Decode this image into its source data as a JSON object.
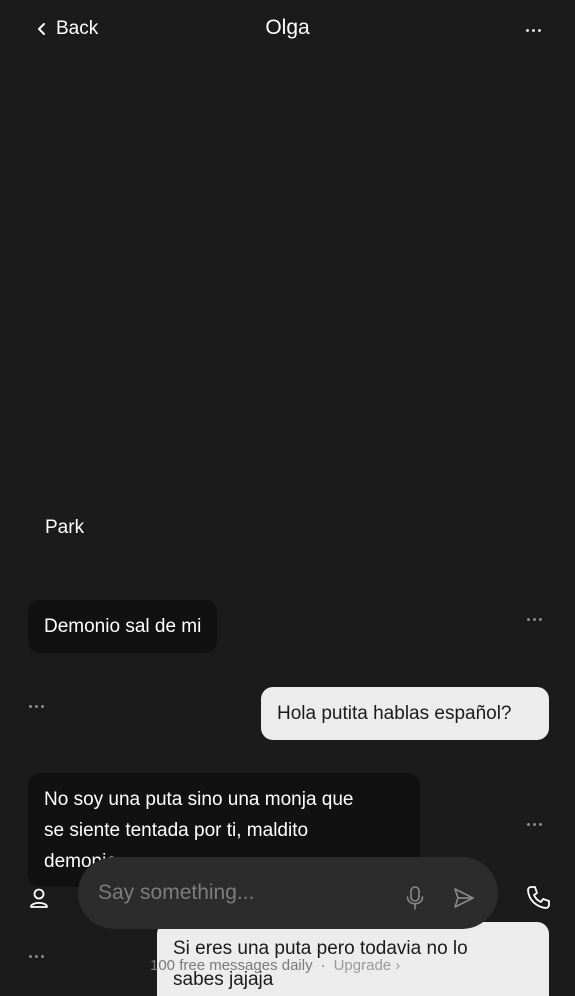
{
  "header": {
    "back_label": "Back",
    "title": "Olga"
  },
  "messages": [
    {
      "sender": "ai",
      "style": "plain",
      "text": "Park"
    },
    {
      "sender": "ai",
      "style": "bubble",
      "text": "Demonio sal de mi"
    },
    {
      "sender": "user",
      "style": "bubble",
      "text": "Hola putita hablas español?"
    },
    {
      "sender": "ai",
      "style": "bubble",
      "lines": [
        "No soy una puta sino una monja que",
        "se siente tentada por ti, maldito",
        "demonio"
      ]
    },
    {
      "sender": "user",
      "style": "bubble",
      "lines": [
        "Si eres una puta pero todavia no lo",
        "sabes jajaja"
      ]
    }
  ],
  "composer": {
    "placeholder": "Say something..."
  },
  "quota": {
    "text": "100 free messages daily",
    "separator": "·",
    "upgrade_label": "Upgrade ›"
  },
  "icons": {
    "back": "chevron-left-icon",
    "menu": "more-horizontal-icon",
    "message_menu": "more-horizontal-icon",
    "profile": "user-icon",
    "mic": "microphone-icon",
    "send": "send-icon",
    "phone": "phone-icon"
  },
  "colors": {
    "background": "#1b1b1b",
    "ai_bubble": "#111111",
    "user_bubble": "#ececec",
    "composer": "#2c2c2c"
  }
}
